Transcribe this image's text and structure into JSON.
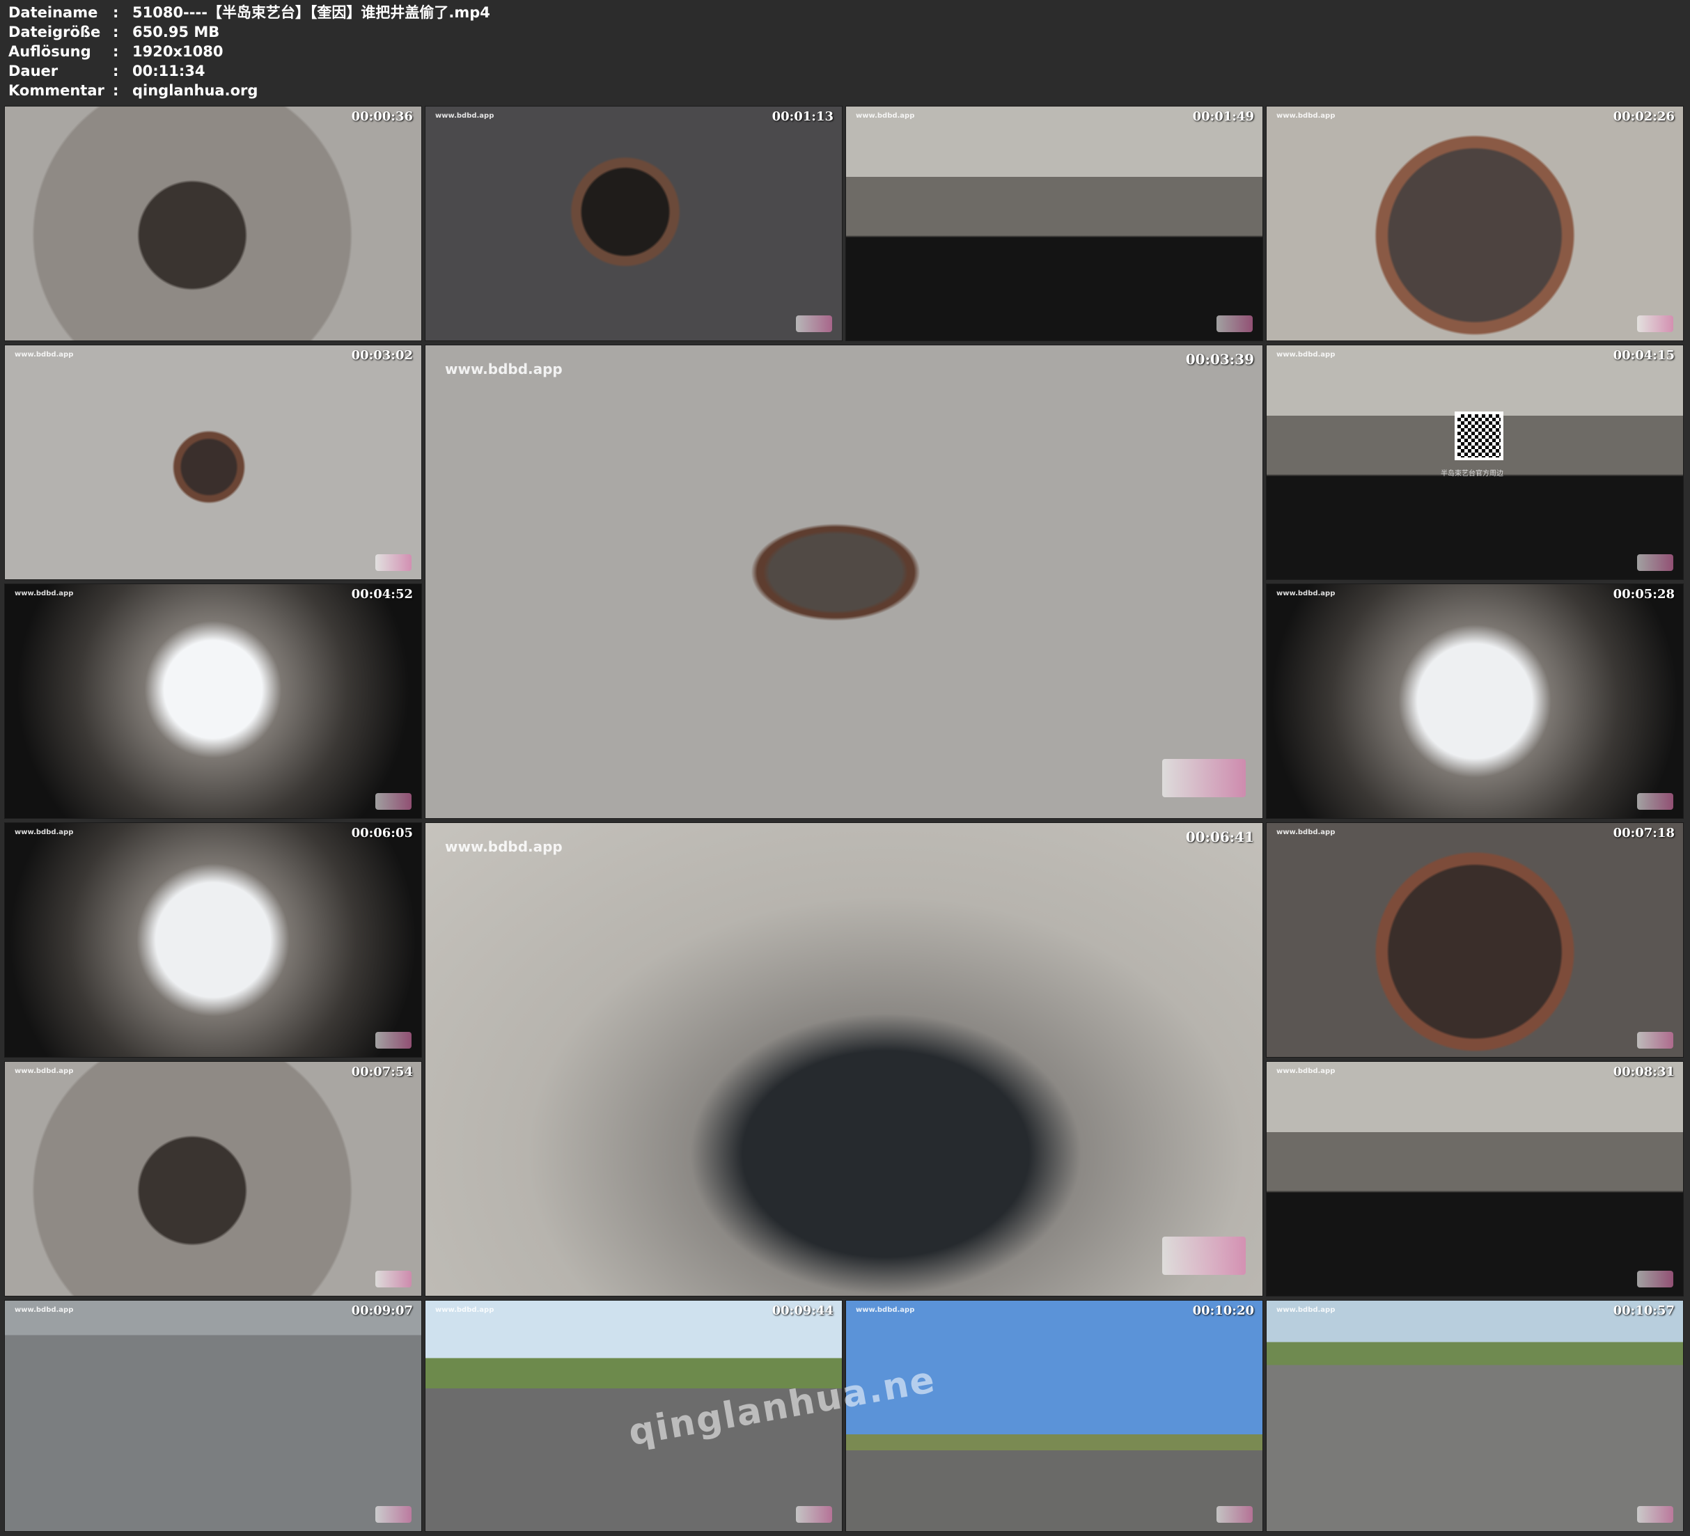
{
  "header": {
    "rows": [
      {
        "key": "Dateiname",
        "sep": ":",
        "value": "51080----【半岛束艺台】【奎因】谁把井盖偷了.mp4"
      },
      {
        "key": "Dateigröße",
        "sep": ":",
        "value": "650.95 MB"
      },
      {
        "key": "Auflösung",
        "sep": ":",
        "value": "1920x1080"
      },
      {
        "key": "Dauer",
        "sep": ":",
        "value": "00:11:34"
      },
      {
        "key": "Kommentar",
        "sep": ":",
        "value": "qinglanhua.org"
      }
    ]
  },
  "watermark": "www.bdbd.app",
  "qr_caption": "半岛束艺台官方周边",
  "overlay_watermark": "qinglanhua.ne",
  "thumbnails": [
    {
      "time": "00:00:36",
      "scene": "hole",
      "watermark": false
    },
    {
      "time": "00:01:13",
      "scene": "asphalt-dark",
      "watermark": true
    },
    {
      "time": "00:01:49",
      "scene": "wall",
      "watermark": true
    },
    {
      "time": "00:02:26",
      "scene": "rusty",
      "watermark": true
    },
    {
      "time": "00:03:02",
      "scene": "asphalt-light",
      "watermark": true
    },
    {
      "time": "00:03:39",
      "scene": "big-asphalt",
      "watermark": true,
      "big": true
    },
    {
      "time": "00:04:15",
      "scene": "wall",
      "watermark": true,
      "qr": true
    },
    {
      "time": "00:04:52",
      "scene": "tunnel",
      "watermark": true
    },
    {
      "time": "00:05:28",
      "scene": "tunnel2",
      "watermark": true
    },
    {
      "time": "00:06:05",
      "scene": "tunnel2",
      "watermark": true
    },
    {
      "time": "00:06:41",
      "scene": "big-hole",
      "watermark": true,
      "big": true
    },
    {
      "time": "00:07:18",
      "scene": "rusty2",
      "watermark": true
    },
    {
      "time": "00:07:54",
      "scene": "hole",
      "watermark": true
    },
    {
      "time": "00:08:31",
      "scene": "wall",
      "watermark": true
    },
    {
      "time": "00:09:07",
      "scene": "road",
      "watermark": true
    },
    {
      "time": "00:09:44",
      "scene": "road-sky",
      "watermark": true
    },
    {
      "time": "00:10:20",
      "scene": "road-sky2",
      "watermark": true
    },
    {
      "time": "00:10:57",
      "scene": "road-sky3",
      "watermark": true
    }
  ]
}
